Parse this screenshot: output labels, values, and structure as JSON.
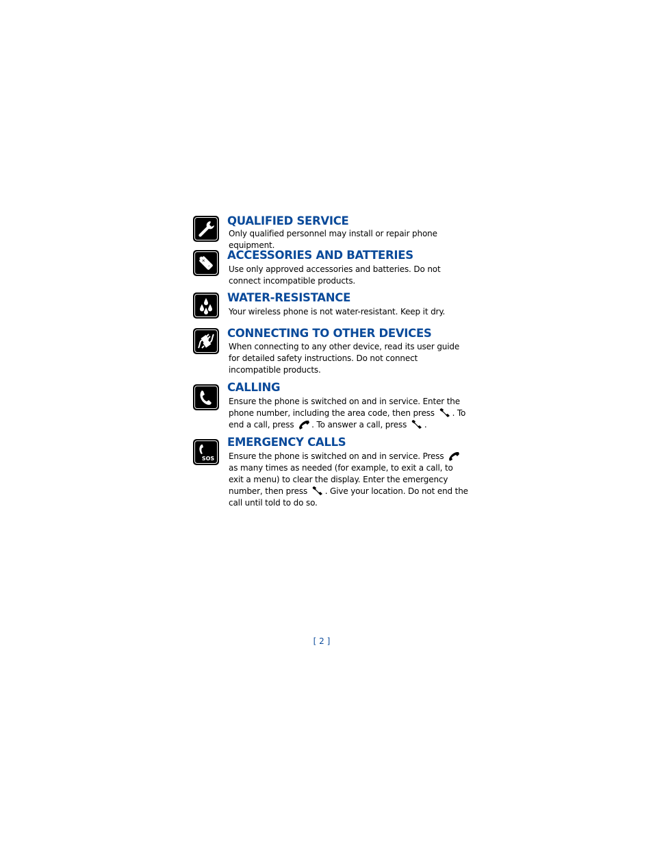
{
  "sections": [
    {
      "icon": "wrench-icon",
      "title": "QUALIFIED SERVICE",
      "body": "Only qualified personnel may install or repair phone equipment."
    },
    {
      "icon": "battery-icon",
      "title": "ACCESSORIES AND BATTERIES",
      "body": "Use only approved accessories and batteries. Do not connect incompatible products."
    },
    {
      "icon": "water-drops-icon",
      "title": "WATER-RESISTANCE",
      "body": "Your wireless phone is not water-resistant. Keep it dry."
    },
    {
      "icon": "plug-icon",
      "title": "CONNECTING TO OTHER DEVICES",
      "body": "When connecting to any other device, read its user guide for detailed safety instructions. Do not connect incompatible products."
    },
    {
      "icon": "phone-handset-icon",
      "title": "CALLING",
      "body_parts": [
        "Ensure the phone is switched on and in service. Enter the phone number, including the area code, then press ",
        ". To end a call, press ",
        ". To answer a call, press ",
        "."
      ],
      "inline_icons": [
        "talk-key-icon",
        "end-key-icon",
        "talk-key-icon"
      ]
    },
    {
      "icon": "sos-phone-icon",
      "title": "EMERGENCY CALLS",
      "icon_label": "SOS",
      "body_parts": [
        "Ensure the phone is switched on and in service. Press ",
        " as many times as needed (for example, to exit a call, to exit a menu) to clear the display. Enter the emergency number, then press ",
        ". Give your location. Do not end the call until told to do so."
      ],
      "inline_icons": [
        "end-key-icon",
        "talk-key-icon"
      ]
    }
  ],
  "footer": {
    "page_number": "[ 2 ]"
  },
  "colors": {
    "heading": "#0a4a9a",
    "icon_bg": "#000000"
  }
}
